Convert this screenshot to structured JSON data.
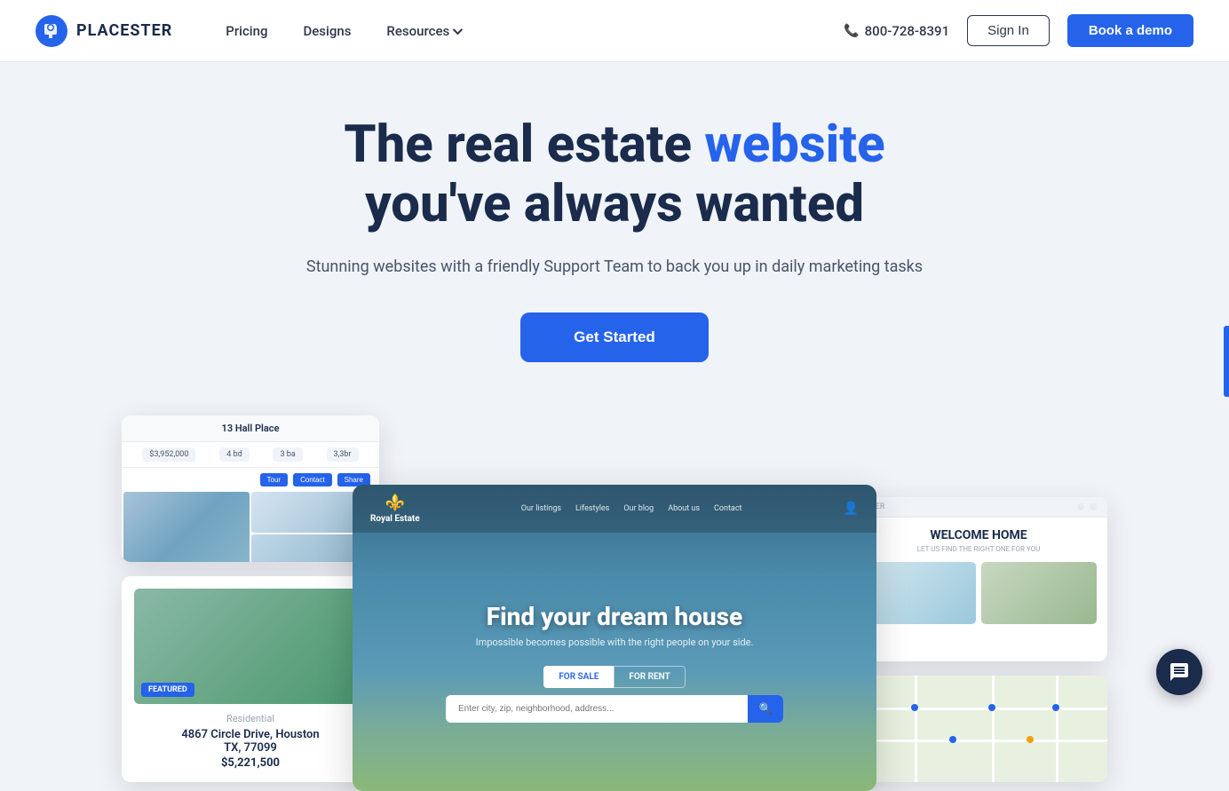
{
  "navbar": {
    "logo_text": "PLACESTER",
    "nav_items": [
      {
        "label": "Pricing",
        "has_dropdown": false
      },
      {
        "label": "Designs",
        "has_dropdown": false
      },
      {
        "label": "Resources",
        "has_dropdown": true
      }
    ],
    "phone": "800-728-8391",
    "signin_label": "Sign In",
    "book_demo_label": "Book a demo"
  },
  "hero": {
    "headline_part1": "The real estate ",
    "headline_highlight": "website",
    "headline_part2": "you've always wanted",
    "subtext": "Stunning websites with a friendly Support Team to back you up in daily marketing tasks",
    "cta_label": "Get Started"
  },
  "center_screenshot": {
    "brand_name": "Royal Estate",
    "nav_links": [
      "Our listings",
      "Lifestyles",
      "Our blog",
      "About us",
      "Contact"
    ],
    "hero_title": "Find your dream house",
    "hero_subtitle": "Impossible becomes possible with the right people on your side.",
    "tab_for_sale": "FOR SALE",
    "tab_for_rent": "FOR RENT",
    "search_placeholder": "Enter city, zip, neighborhood, address..."
  },
  "card_top": {
    "address": "13 Hall Place",
    "price": "$3,952,000",
    "beds": "4",
    "baths": "3",
    "sqft": "3,3br"
  },
  "card_listing": {
    "featured_label": "FEATURED",
    "type": "Residential",
    "address": "4867 Circle Drive, Houston",
    "state": "TX, 77099",
    "price": "$5,221,500"
  },
  "card_welcome": {
    "header_text": "ADLER",
    "title": "WELCOME HOME",
    "subtitle": "LET US FIND THE RIGHT ONE FOR YOU"
  },
  "chat_button": {
    "icon": "💬"
  }
}
